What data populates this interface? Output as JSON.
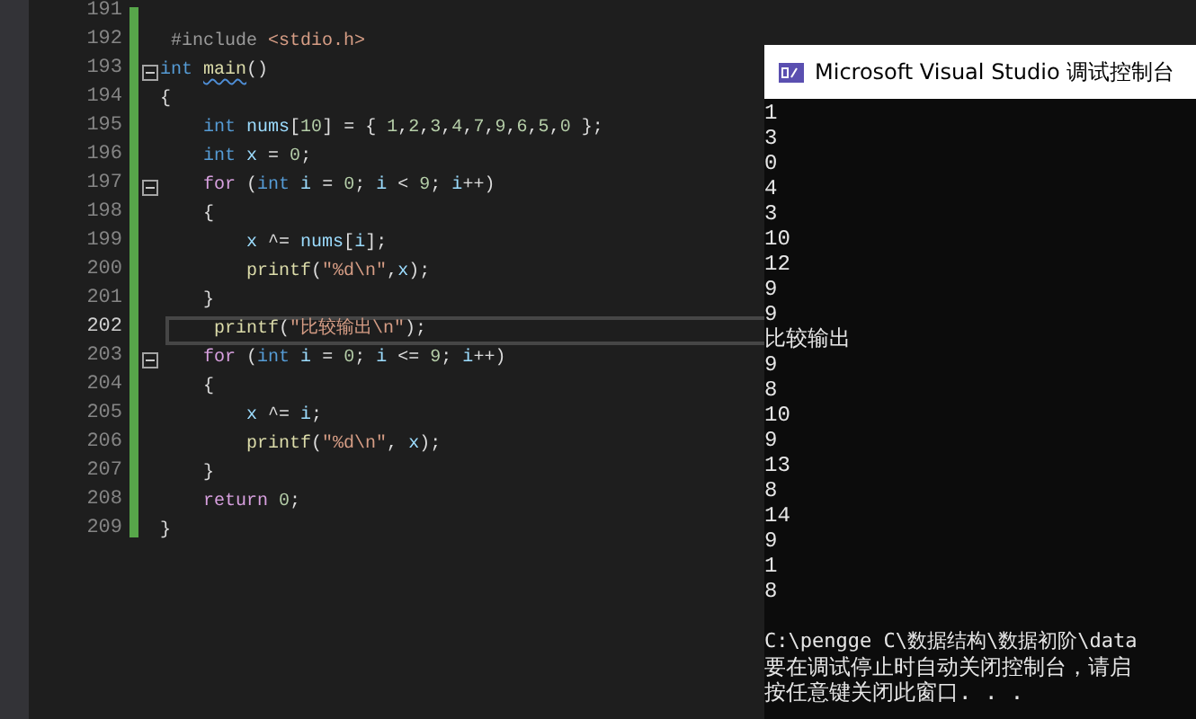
{
  "editor": {
    "lines": [
      {
        "number": "191",
        "fold": false,
        "selected": false
      },
      {
        "number": "192",
        "fold": false,
        "selected": false,
        "tokens": [
          {
            "text": " #include ",
            "kind": "directive"
          },
          {
            "text": "<stdio.h>",
            "kind": "string"
          }
        ]
      },
      {
        "number": "193",
        "fold": true,
        "selected": false,
        "tokens": [
          {
            "text": "int ",
            "kind": "keyword"
          },
          {
            "text": "main",
            "kind": "func",
            "squiggle": true
          },
          {
            "text": "()",
            "kind": "plain"
          }
        ]
      },
      {
        "number": "194",
        "fold": false,
        "selected": false,
        "tokens": [
          {
            "text": "{",
            "kind": "plain"
          }
        ]
      },
      {
        "number": "195",
        "fold": false,
        "selected": false,
        "tokens": [
          {
            "text": "    int",
            "kind": "keyword"
          },
          {
            "text": " nums",
            "kind": "var"
          },
          {
            "text": "[",
            "kind": "plain"
          },
          {
            "text": "10",
            "kind": "number"
          },
          {
            "text": "] = { ",
            "kind": "plain"
          },
          {
            "text": "1",
            "kind": "number"
          },
          {
            "text": ",",
            "kind": "plain"
          },
          {
            "text": "2",
            "kind": "number"
          },
          {
            "text": ",",
            "kind": "plain"
          },
          {
            "text": "3",
            "kind": "number"
          },
          {
            "text": ",",
            "kind": "plain"
          },
          {
            "text": "4",
            "kind": "number"
          },
          {
            "text": ",",
            "kind": "plain"
          },
          {
            "text": "7",
            "kind": "number"
          },
          {
            "text": ",",
            "kind": "plain"
          },
          {
            "text": "9",
            "kind": "number"
          },
          {
            "text": ",",
            "kind": "plain"
          },
          {
            "text": "6",
            "kind": "number"
          },
          {
            "text": ",",
            "kind": "plain"
          },
          {
            "text": "5",
            "kind": "number"
          },
          {
            "text": ",",
            "kind": "plain"
          },
          {
            "text": "0",
            "kind": "number"
          },
          {
            "text": " };",
            "kind": "plain"
          }
        ]
      },
      {
        "number": "196",
        "fold": false,
        "selected": false,
        "tokens": [
          {
            "text": "    int",
            "kind": "keyword"
          },
          {
            "text": " x",
            "kind": "var"
          },
          {
            "text": " = ",
            "kind": "plain"
          },
          {
            "text": "0",
            "kind": "number"
          },
          {
            "text": ";",
            "kind": "plain"
          }
        ]
      },
      {
        "number": "197",
        "fold": true,
        "selected": false,
        "tokens": [
          {
            "text": "    for",
            "kind": "control"
          },
          {
            "text": " (",
            "kind": "plain"
          },
          {
            "text": "int",
            "kind": "keyword"
          },
          {
            "text": " i",
            "kind": "var"
          },
          {
            "text": " = ",
            "kind": "plain"
          },
          {
            "text": "0",
            "kind": "number"
          },
          {
            "text": "; ",
            "kind": "plain"
          },
          {
            "text": "i",
            "kind": "var"
          },
          {
            "text": " < ",
            "kind": "plain"
          },
          {
            "text": "9",
            "kind": "number"
          },
          {
            "text": "; ",
            "kind": "plain"
          },
          {
            "text": "i",
            "kind": "var"
          },
          {
            "text": "++)",
            "kind": "plain"
          }
        ]
      },
      {
        "number": "198",
        "fold": false,
        "selected": false,
        "tokens": [
          {
            "text": "    {",
            "kind": "plain"
          }
        ]
      },
      {
        "number": "199",
        "fold": false,
        "selected": false,
        "tokens": [
          {
            "text": "        x",
            "kind": "var"
          },
          {
            "text": " ^= ",
            "kind": "plain"
          },
          {
            "text": "nums",
            "kind": "var"
          },
          {
            "text": "[",
            "kind": "plain"
          },
          {
            "text": "i",
            "kind": "var"
          },
          {
            "text": "];",
            "kind": "plain"
          }
        ]
      },
      {
        "number": "200",
        "fold": false,
        "selected": false,
        "tokens": [
          {
            "text": "        printf",
            "kind": "func"
          },
          {
            "text": "(",
            "kind": "plain"
          },
          {
            "text": "\"%d\\n\"",
            "kind": "string"
          },
          {
            "text": ",",
            "kind": "plain"
          },
          {
            "text": "x",
            "kind": "var"
          },
          {
            "text": ");",
            "kind": "plain"
          }
        ]
      },
      {
        "number": "201",
        "fold": false,
        "selected": false,
        "tokens": [
          {
            "text": "    }",
            "kind": "plain"
          }
        ]
      },
      {
        "number": "202",
        "fold": false,
        "selected": true,
        "tokens": [
          {
            "text": "    printf",
            "kind": "func"
          },
          {
            "text": "(",
            "kind": "plain"
          },
          {
            "text": "\"比较输出\\n\"",
            "kind": "string"
          },
          {
            "text": ");",
            "kind": "plain"
          }
        ]
      },
      {
        "number": "203",
        "fold": true,
        "selected": false,
        "tokens": [
          {
            "text": "    for",
            "kind": "control"
          },
          {
            "text": " (",
            "kind": "plain"
          },
          {
            "text": "int",
            "kind": "keyword"
          },
          {
            "text": " i",
            "kind": "var"
          },
          {
            "text": " = ",
            "kind": "plain"
          },
          {
            "text": "0",
            "kind": "number"
          },
          {
            "text": "; ",
            "kind": "plain"
          },
          {
            "text": "i",
            "kind": "var"
          },
          {
            "text": " <= ",
            "kind": "plain"
          },
          {
            "text": "9",
            "kind": "number"
          },
          {
            "text": "; ",
            "kind": "plain"
          },
          {
            "text": "i",
            "kind": "var"
          },
          {
            "text": "++)",
            "kind": "plain"
          }
        ]
      },
      {
        "number": "204",
        "fold": false,
        "selected": false,
        "tokens": [
          {
            "text": "    {",
            "kind": "plain"
          }
        ]
      },
      {
        "number": "205",
        "fold": false,
        "selected": false,
        "tokens": [
          {
            "text": "        x",
            "kind": "var"
          },
          {
            "text": " ^= ",
            "kind": "plain"
          },
          {
            "text": "i",
            "kind": "var"
          },
          {
            "text": ";",
            "kind": "plain"
          }
        ]
      },
      {
        "number": "206",
        "fold": false,
        "selected": false,
        "tokens": [
          {
            "text": "        printf",
            "kind": "func"
          },
          {
            "text": "(",
            "kind": "plain"
          },
          {
            "text": "\"%d\\n\"",
            "kind": "string"
          },
          {
            "text": ", ",
            "kind": "plain"
          },
          {
            "text": "x",
            "kind": "var"
          },
          {
            "text": ");",
            "kind": "plain"
          }
        ]
      },
      {
        "number": "207",
        "fold": false,
        "selected": false,
        "tokens": [
          {
            "text": "    }",
            "kind": "plain"
          }
        ]
      },
      {
        "number": "208",
        "fold": false,
        "selected": false,
        "tokens": [
          {
            "text": "    return ",
            "kind": "control"
          },
          {
            "text": "0",
            "kind": "number"
          },
          {
            "text": ";",
            "kind": "plain"
          }
        ]
      },
      {
        "number": "209",
        "fold": false,
        "selected": false,
        "tokens": [
          {
            "text": "}",
            "kind": "plain"
          }
        ]
      }
    ]
  },
  "console": {
    "title": "Microsoft Visual Studio 调试控制台",
    "output": [
      "1",
      "3",
      "0",
      "4",
      "3",
      "10",
      "12",
      "9",
      "9",
      "比较输出",
      "9",
      "8",
      "10",
      "9",
      "13",
      "8",
      "14",
      "9",
      "1",
      "8"
    ],
    "messages": [
      "C:\\pengge C\\数据结构\\数据初阶\\data",
      "要在调试停止时自动关闭控制台，请启",
      "按任意键关闭此窗口. . ."
    ]
  }
}
